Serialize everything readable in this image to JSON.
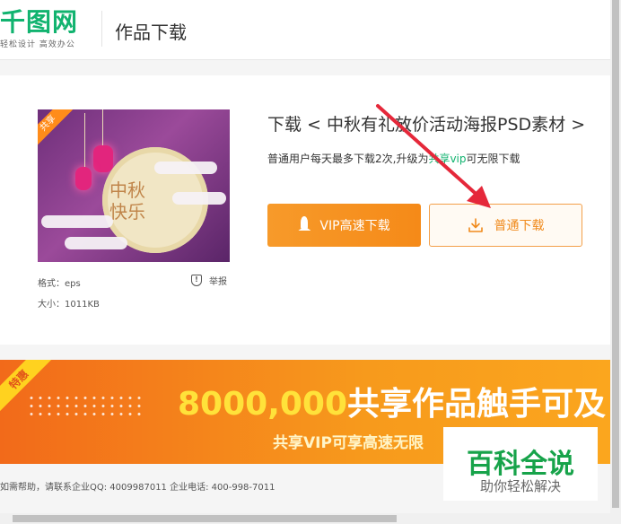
{
  "header": {
    "logo_text": "千图网",
    "logo_tagline": "轻松设计 高效办公",
    "page_title": "作品下载"
  },
  "product": {
    "thumb_badge": "共享",
    "thumb_text_line1": "中秋",
    "thumb_text_line2": "快乐",
    "format_label": "格式：eps",
    "size_label": "大小：1011KB",
    "report_label": "举报",
    "download_title": "下载 < 中秋有礼放价活动海报PSD素材 >",
    "desc_before": "普通用户每天最多下载2次,升级为",
    "desc_vip": "共享vip",
    "desc_after": "可无限下载"
  },
  "buttons": {
    "vip_label": "VIP高速下载",
    "normal_label": "普通下载"
  },
  "banner": {
    "badge": "特惠",
    "big_number": "8000,000",
    "big_text": "共享作品触手可及",
    "small_text": "共享VIP可享高速无限"
  },
  "footer": {
    "help_text": "如需帮助，请联系企业QQ: 4009987011 企业电话: 400-998-7011"
  },
  "watermark": {
    "title": "百科全说",
    "subtitle": "助你轻松解决"
  },
  "colors": {
    "brand_green": "#11b36f",
    "accent_orange": "#f58a18",
    "arrow_red": "#e5283a"
  },
  "icons": {
    "rocket": "rocket-icon",
    "download": "download-icon",
    "report": "report-icon"
  }
}
